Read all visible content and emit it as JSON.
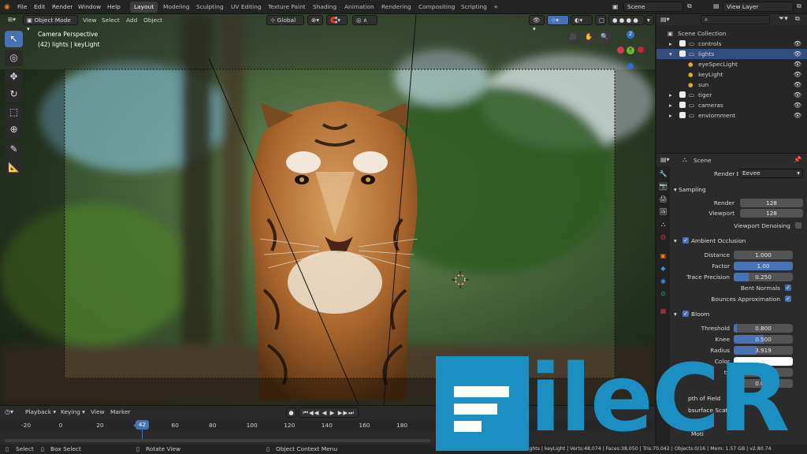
{
  "menu": [
    "File",
    "Edit",
    "Render",
    "Window",
    "Help"
  ],
  "workspaces": [
    "Layout",
    "Modeling",
    "Sculpting",
    "UV Editing",
    "Texture Paint",
    "Shading",
    "Animation",
    "Rendering",
    "Compositing",
    "Scripting"
  ],
  "add_workspace": "+",
  "scene": {
    "label": "Scene",
    "view_layer": "View Layer"
  },
  "viewport": {
    "mode": "Object Mode",
    "header_menus": [
      "View",
      "Select",
      "Add",
      "Object"
    ],
    "transform_orientation": "Global",
    "overlay_title": "Camera Perspective",
    "overlay_sub": "(42) lights | keyLight",
    "gizmo_axes": {
      "z": "Z",
      "y": "Y",
      "x": "X"
    }
  },
  "outliner": {
    "root": "Scene Collection",
    "rows": [
      {
        "label": "controls",
        "indent": 1
      },
      {
        "label": "lights",
        "indent": 1,
        "selected": true
      },
      {
        "label": "eyeSpecLight",
        "indent": 2
      },
      {
        "label": "keyLight",
        "indent": 2
      },
      {
        "label": "sun",
        "indent": 2
      },
      {
        "label": "tiger",
        "indent": 1
      },
      {
        "label": "cameras",
        "indent": 1
      },
      {
        "label": "enviornment",
        "indent": 1
      }
    ]
  },
  "properties": {
    "context": "Scene",
    "render_engine_label": "Render Engine",
    "render_engine": "Eevee",
    "sampling": {
      "title": "Sampling",
      "render_label": "Render",
      "render": "128",
      "viewport_label": "Viewport",
      "viewport": "128",
      "denoise_label": "Viewport Denoising"
    },
    "ao": {
      "title": "Ambient Occlusion",
      "distance_label": "Distance",
      "distance": "1.000",
      "factor_label": "Factor",
      "factor": "1.00",
      "factor_fill": 1.0,
      "trace_label": "Trace Precision",
      "trace": "0.250",
      "trace_fill": 0.25,
      "bent_label": "Bent Normals",
      "bounces_label": "Bounces Approximation"
    },
    "bloom": {
      "title": "Bloom",
      "threshold_label": "Threshold",
      "threshold": "0.800",
      "knee_label": "Knee",
      "knee": "0.500",
      "knee_fill": 0.5,
      "radius_label": "Radius",
      "radius": "3.919",
      "radius_fill": 0.39,
      "color_label": "Color",
      "intensity_label": "ty",
      "intensity": "",
      "clamp": "0.000"
    },
    "more": [
      "pth of Field",
      "bsurface Scatter",
      "Scre",
      "Moti"
    ],
    "color_swatch": "#ffffff"
  },
  "timeline": {
    "menus": [
      "Playback",
      "Keying",
      "View",
      "Marker"
    ],
    "ticks": [
      "-20",
      "0",
      "20",
      "40",
      "60",
      "80",
      "100",
      "120",
      "140",
      "160",
      "180"
    ],
    "current_frame": "42",
    "right_ticks": [
      "300"
    ]
  },
  "status": {
    "select": "Select",
    "box_select": "Box Select",
    "rotate_view": "Rotate View",
    "context_menu": "Object Context Menu",
    "stats": "lights | keyLight | Verts:48,074 | Faces:38,050 | Tris:70,042 | Objects:0/16 | Mem: 1.57 GB | v2.80.74"
  },
  "watermark": {
    "text": "ileCR"
  },
  "colors": {
    "accent": "#4772b3",
    "selected_row": "#334d80",
    "watermark": "#1c8fc2"
  }
}
